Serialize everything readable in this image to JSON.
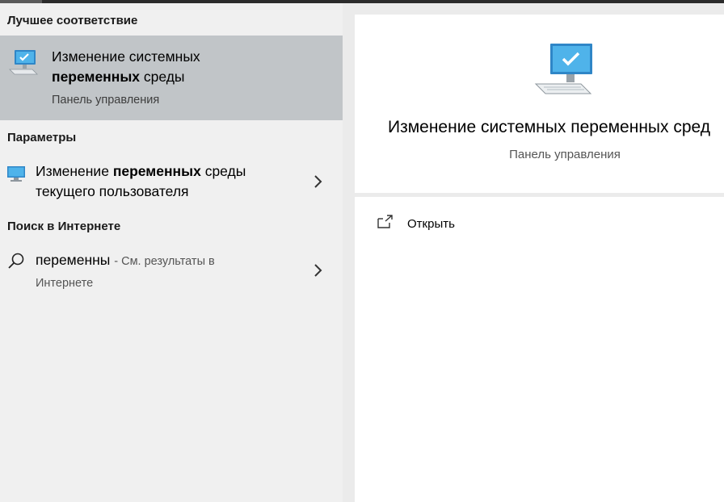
{
  "sections": {
    "best_match": "Лучшее соответствие",
    "settings": "Параметры",
    "web_search": "Поиск в Интернете"
  },
  "best_match_item": {
    "title_normal": "Изменение системных",
    "title_bold": "переменных",
    "title_tail": "среды",
    "subtitle": "Панель управления",
    "icon": "monitor-check-icon"
  },
  "settings_item": {
    "title_prefix": "Изменение",
    "title_bold": "переменных",
    "title_suffix": "среды",
    "title_line2": "текущего пользователя",
    "icon": "monitor-settings-icon"
  },
  "web_item": {
    "query": "переменны",
    "hint": "- См. результаты в",
    "hint_line2": "Интернете",
    "icon": "search-icon"
  },
  "detail": {
    "title": "Изменение системных переменных сред",
    "subtitle": "Панель управления",
    "actions": [
      {
        "label": "Открыть",
        "icon": "open-external-icon"
      }
    ]
  },
  "colors": {
    "selected_bg": "#c1c5c8",
    "panel_bg": "#f0f0f0",
    "accent_monitor": "#3aa0dc"
  }
}
